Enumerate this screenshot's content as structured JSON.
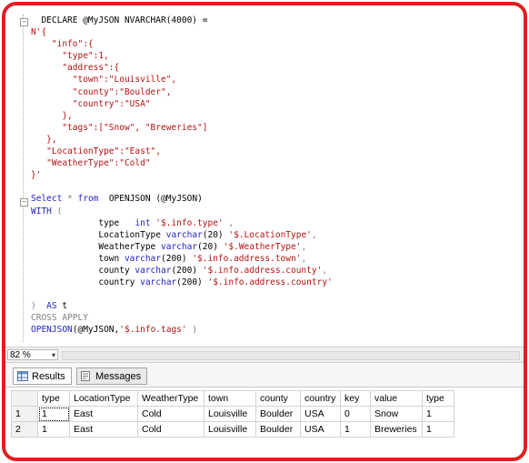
{
  "editor": {
    "lines": [
      [
        {
          "t": "  DECLARE @MyJSON NVARCHAR(4000) =",
          "c": "plain"
        }
      ],
      [
        {
          "t": "N'{",
          "c": "str"
        }
      ],
      [
        {
          "t": "    \"info\":{",
          "c": "str"
        }
      ],
      [
        {
          "t": "      \"type\":1,",
          "c": "str"
        }
      ],
      [
        {
          "t": "      \"address\":{",
          "c": "str"
        }
      ],
      [
        {
          "t": "        \"town\":\"Louisville\",",
          "c": "str"
        }
      ],
      [
        {
          "t": "        \"county\":\"Boulder\",",
          "c": "str"
        }
      ],
      [
        {
          "t": "        \"country\":\"USA\"",
          "c": "str"
        }
      ],
      [
        {
          "t": "      },",
          "c": "str"
        }
      ],
      [
        {
          "t": "      \"tags\":[\"Snow\", \"Breweries\"]",
          "c": "str"
        }
      ],
      [
        {
          "t": "   },",
          "c": "str"
        }
      ],
      [
        {
          "t": "   \"LocationType\":\"East\",",
          "c": "str"
        }
      ],
      [
        {
          "t": "   \"WeatherType\":\"Cold\"",
          "c": "str"
        }
      ],
      [
        {
          "t": "}'",
          "c": "str"
        }
      ],
      [
        {
          "t": "",
          "c": "plain"
        }
      ],
      [
        {
          "t": "Select",
          "c": "kw"
        },
        {
          "t": " * ",
          "c": "gray"
        },
        {
          "t": "from",
          "c": "kw"
        },
        {
          "t": "  OPENJSON ",
          "c": "plain"
        },
        {
          "t": "(@MyJSON)",
          "c": "plain"
        }
      ],
      [
        {
          "t": "WITH",
          "c": "kw"
        },
        {
          "t": " (",
          "c": "gray"
        }
      ],
      [
        {
          "t": "             type   ",
          "c": "plain"
        },
        {
          "t": "int",
          "c": "kw"
        },
        {
          "t": " '$.info.type'",
          "c": "str"
        },
        {
          "t": " ,",
          "c": "gray"
        }
      ],
      [
        {
          "t": "             LocationType ",
          "c": "plain"
        },
        {
          "t": "varchar",
          "c": "kw"
        },
        {
          "t": "(20) ",
          "c": "plain"
        },
        {
          "t": "'$.LocationType'",
          "c": "str"
        },
        {
          "t": ",",
          "c": "gray"
        }
      ],
      [
        {
          "t": "             WeatherType ",
          "c": "plain"
        },
        {
          "t": "varchar",
          "c": "kw"
        },
        {
          "t": "(20) ",
          "c": "plain"
        },
        {
          "t": "'$.WeatherType'",
          "c": "str"
        },
        {
          "t": ",",
          "c": "gray"
        }
      ],
      [
        {
          "t": "             town ",
          "c": "plain"
        },
        {
          "t": "varchar",
          "c": "kw"
        },
        {
          "t": "(200) ",
          "c": "plain"
        },
        {
          "t": "'$.info.address.town'",
          "c": "str"
        },
        {
          "t": ",",
          "c": "gray"
        }
      ],
      [
        {
          "t": "             county ",
          "c": "plain"
        },
        {
          "t": "varchar",
          "c": "kw"
        },
        {
          "t": "(200) ",
          "c": "plain"
        },
        {
          "t": "'$.info.address.county'",
          "c": "str"
        },
        {
          "t": ",",
          "c": "gray"
        }
      ],
      [
        {
          "t": "             country ",
          "c": "plain"
        },
        {
          "t": "varchar",
          "c": "kw"
        },
        {
          "t": "(200) ",
          "c": "plain"
        },
        {
          "t": "'$.info.address.country'",
          "c": "str"
        }
      ],
      [
        {
          "t": "",
          "c": "plain"
        }
      ],
      [
        {
          "t": ")  ",
          "c": "gray"
        },
        {
          "t": "AS",
          "c": "kw"
        },
        {
          "t": " t",
          "c": "plain"
        }
      ],
      [
        {
          "t": "CROSS APPLY",
          "c": "gray"
        }
      ],
      [
        {
          "t": "OPENJSON",
          "c": "kw"
        },
        {
          "t": "(@MyJSON,",
          "c": "plain"
        },
        {
          "t": "'$.info.tags'",
          "c": "str"
        },
        {
          "t": " )",
          "c": "gray"
        }
      ]
    ]
  },
  "zoom": {
    "value": "82 %",
    "dropdown_glyph": "▾"
  },
  "tabs": [
    {
      "label": "Results",
      "icon": "grid-icon",
      "active": true
    },
    {
      "label": "Messages",
      "icon": "messages-icon",
      "active": false
    }
  ],
  "results": {
    "columns": [
      "type",
      "LocationType",
      "WeatherType",
      "town",
      "county",
      "country",
      "key",
      "value",
      "type"
    ],
    "rows": [
      {
        "num": "1",
        "cells": [
          "1",
          "East",
          "Cold",
          "Louisville",
          "Boulder",
          "USA",
          "0",
          "Snow",
          "1"
        ]
      },
      {
        "num": "2",
        "cells": [
          "1",
          "East",
          "Cold",
          "Louisville",
          "Boulder",
          "USA",
          "1",
          "Breweries",
          "1"
        ]
      }
    ]
  },
  "colors": {
    "border": "#e01f1f",
    "keyword": "#1f1fbf",
    "string": "#b21212"
  }
}
